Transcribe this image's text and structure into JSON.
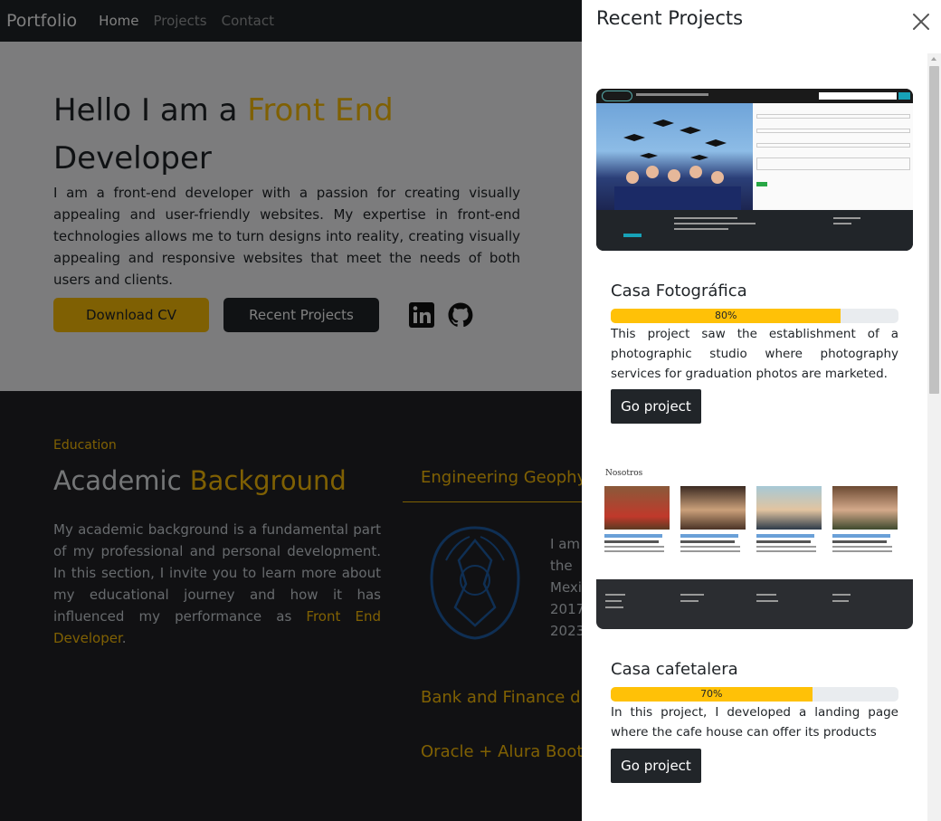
{
  "navbar": {
    "brand": "Portfolio",
    "links": [
      "Home",
      "Projects",
      "Contact"
    ]
  },
  "hero": {
    "title_prefix": "Hello I am a ",
    "title_highlight": "Front End",
    "title_suffix": "Developer",
    "description": "I am a front-end developer with a passion for creating visually appealing and user-friendly websites. My expertise in front-end technologies allows me to turn designs into reality, creating visually appealing and responsive websites that meet the needs of both users and clients.",
    "download_cv_label": "Download CV",
    "recent_projects_label": "Recent Projects",
    "social_icons": [
      "linkedin-icon",
      "github-icon"
    ]
  },
  "education": {
    "kicker": "Education",
    "title_plain": "Academic ",
    "title_highlight": "Background",
    "text_plain": "My academic background is a fundamental part of my professional and personal development. In this section, I invite you to learn more about my educational journey and how it has influenced my performance as ",
    "text_highlight": "Front End Developer",
    "text_end": ".",
    "tabs": [
      "Engineering Geophy",
      "Bank and Finance di",
      "Oracle + Alura Boot"
    ],
    "detail_lines": [
      "I am",
      "the",
      "Mexi",
      "2017",
      "2023"
    ]
  },
  "panel": {
    "title": "Recent Projects",
    "projects": [
      {
        "name": "Casa Fotográfica",
        "progress": 80,
        "progress_label": "80%",
        "description": "This project saw the establishment of a photographic studio where photography services for graduation photos are marketed.",
        "button_label": "Go project"
      },
      {
        "name": "Casa cafetalera",
        "progress": 70,
        "progress_label": "70%",
        "description": "In this project, I developed a landing page where the cafe house can offer its products",
        "button_label": "Go project"
      }
    ],
    "thumb2_heading": "Nosotros"
  },
  "colors": {
    "accent": "#ffc107",
    "dark": "#212529",
    "panel_bg": "#ffffff"
  }
}
